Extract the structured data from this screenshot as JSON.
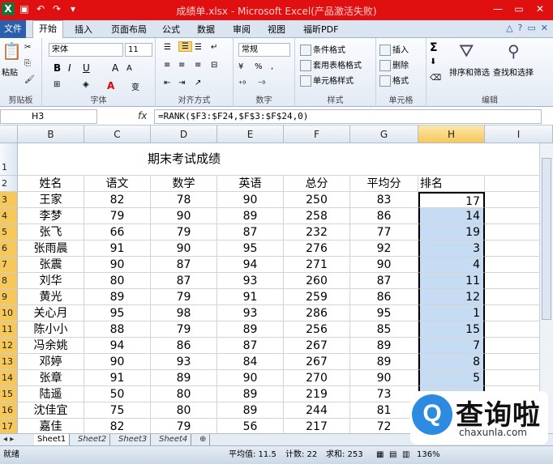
{
  "window": {
    "title": "成绩单.xlsx - Microsoft Excel(产品激活失败)",
    "buttons": [
      "—",
      "▭",
      "✕"
    ]
  },
  "quick_access": {
    "save_icon": "save-icon",
    "undo_icon": "undo-icon",
    "redo_icon": "redo-icon"
  },
  "tabs": [
    {
      "label": "文件"
    },
    {
      "label": "开始"
    },
    {
      "label": "插入"
    },
    {
      "label": "页面布局"
    },
    {
      "label": "公式"
    },
    {
      "label": "数据"
    },
    {
      "label": "审阅"
    },
    {
      "label": "视图"
    },
    {
      "label": "福昕PDF"
    }
  ],
  "ribbon": {
    "clipboard": {
      "paste": "粘贴",
      "label": "剪贴板"
    },
    "font": {
      "name": "宋体",
      "size": "11",
      "label": "字体",
      "bold": "B",
      "italic": "I",
      "underline": "U",
      "font_color": "A",
      "font_size_up": "A",
      "font_size_down": "A",
      "phonetic": "变"
    },
    "alignment": {
      "label": "对齐方式"
    },
    "number": {
      "format": "常规",
      "label": "数字",
      "percent": "%",
      "comma": ","
    },
    "styles": {
      "cond": "条件格式",
      "table": "套用表格格式",
      "cell": "单元格样式",
      "label": "样式"
    },
    "cells": {
      "insert": "插入",
      "delete": "删除",
      "format": "格式",
      "label": "单元格"
    },
    "editing": {
      "sigma": "Σ",
      "sort": "排序和筛选",
      "find": "查找和选择",
      "label": "编辑"
    }
  },
  "formula_bar": {
    "name_box": "H3",
    "fx": "fx",
    "formula": "=RANK($F3:$F24,$F$3:$F$24,0)"
  },
  "columns": [
    "B",
    "C",
    "D",
    "E",
    "F",
    "G",
    "H",
    "I"
  ],
  "rows": [
    "1",
    "2",
    "3",
    "4",
    "5",
    "6",
    "7",
    "8",
    "9",
    "10",
    "11",
    "12",
    "13",
    "14",
    "15",
    "16",
    "17"
  ],
  "sheet_title": "期末考试成绩",
  "table": {
    "headers": [
      "姓名",
      "语文",
      "数学",
      "英语",
      "总分",
      "平均分",
      "排名"
    ],
    "rows": [
      [
        "王家",
        "82",
        "78",
        "90",
        "250",
        "83",
        "17"
      ],
      [
        "李梦",
        "79",
        "90",
        "89",
        "258",
        "86",
        "14"
      ],
      [
        "张飞",
        "66",
        "79",
        "87",
        "232",
        "77",
        "19"
      ],
      [
        "张雨晨",
        "91",
        "90",
        "95",
        "276",
        "92",
        "3"
      ],
      [
        "张震",
        "90",
        "87",
        "94",
        "271",
        "90",
        "4"
      ],
      [
        "刘华",
        "80",
        "87",
        "93",
        "260",
        "87",
        "11"
      ],
      [
        "黄光",
        "89",
        "79",
        "91",
        "259",
        "86",
        "12"
      ],
      [
        "关心月",
        "95",
        "98",
        "93",
        "286",
        "95",
        "1"
      ],
      [
        "陈小小",
        "88",
        "79",
        "89",
        "256",
        "85",
        "15"
      ],
      [
        "冯余姚",
        "94",
        "86",
        "87",
        "267",
        "89",
        "7"
      ],
      [
        "邓婷",
        "90",
        "93",
        "84",
        "267",
        "89",
        "8"
      ],
      [
        "张章",
        "91",
        "89",
        "90",
        "270",
        "90",
        "5"
      ],
      [
        "陆遥",
        "50",
        "80",
        "89",
        "219",
        "73",
        ""
      ],
      [
        "沈佳宜",
        "75",
        "80",
        "89",
        "244",
        "81",
        ""
      ],
      [
        "嘉佳",
        "82",
        "79",
        "56",
        "217",
        "72",
        ""
      ]
    ]
  },
  "sheet_tabs": [
    "Sheet1",
    "Sheet2",
    "Sheet3",
    "Sheet4"
  ],
  "status": {
    "mode": "就绪",
    "average": "平均值: 11.5",
    "count": "计数: 22",
    "sum": "求和: 253",
    "zoom": "136%"
  },
  "watermark": {
    "glyph": "Q",
    "text": "查询啦",
    "url": "chaxunla.com"
  }
}
